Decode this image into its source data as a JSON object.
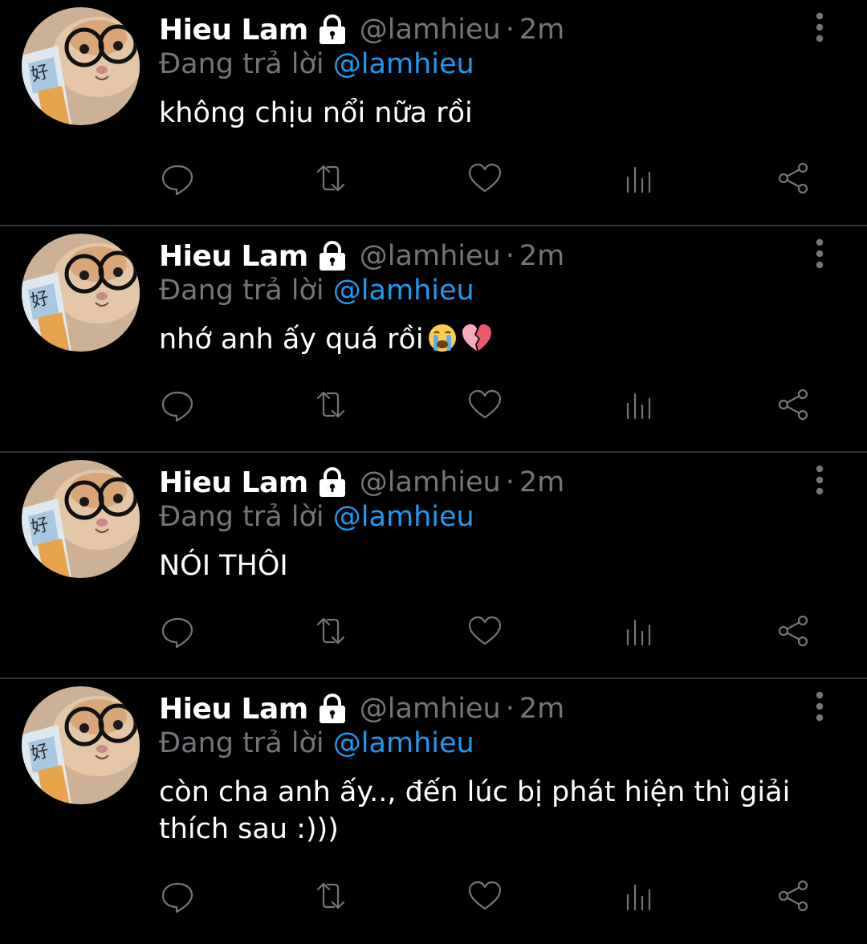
{
  "colors": {
    "background": "#000000",
    "divider": "#2f3336",
    "muted": "#71767b",
    "mention": "#1d9bf0",
    "text": "#ffffff"
  },
  "tweets": [
    {
      "name": "Hieu Lam",
      "handle": "@lamhieu",
      "separator": "·",
      "time": "2m",
      "reply_prefix": "Đang trả lời",
      "reply_to": "@lamhieu",
      "text": "không chịu nổi nữa rồi",
      "emoji": [],
      "icons": [
        "lock-icon",
        "more-vertical-icon",
        "reply-icon",
        "retweet-icon",
        "like-icon",
        "analytics-icon",
        "share-icon"
      ]
    },
    {
      "name": "Hieu Lam",
      "handle": "@lamhieu",
      "separator": "·",
      "time": "2m",
      "reply_prefix": "Đang trả lời",
      "reply_to": "@lamhieu",
      "text": "nhớ anh ấy quá rồi",
      "emoji": [
        "loudly-crying-face-emoji",
        "broken-heart-emoji"
      ],
      "icons": [
        "lock-icon",
        "more-vertical-icon",
        "reply-icon",
        "retweet-icon",
        "like-icon",
        "analytics-icon",
        "share-icon"
      ]
    },
    {
      "name": "Hieu Lam",
      "handle": "@lamhieu",
      "separator": "·",
      "time": "2m",
      "reply_prefix": "Đang trả lời",
      "reply_to": "@lamhieu",
      "text": "NÓI THÔI",
      "emoji": [],
      "icons": [
        "lock-icon",
        "more-vertical-icon",
        "reply-icon",
        "retweet-icon",
        "like-icon",
        "analytics-icon",
        "share-icon"
      ]
    },
    {
      "name": "Hieu Lam",
      "handle": "@lamhieu",
      "separator": "·",
      "time": "2m",
      "reply_prefix": "Đang trả lời",
      "reply_to": "@lamhieu",
      "text_line1": "còn cha anh ấy.., đến lúc bị phát hiện thì giải",
      "text_line2": "thích sau :)))",
      "emoji": [],
      "icons": [
        "lock-icon",
        "more-vertical-icon",
        "reply-icon",
        "retweet-icon",
        "like-icon",
        "analytics-icon",
        "share-icon"
      ]
    }
  ]
}
